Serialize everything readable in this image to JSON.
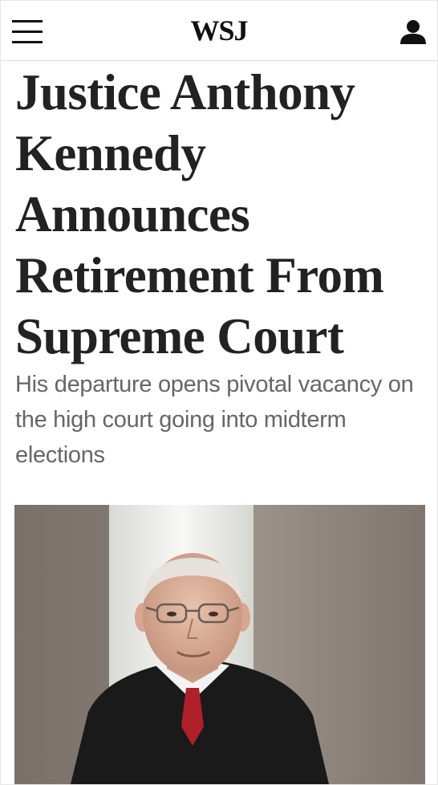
{
  "header": {
    "logo": "WSJ",
    "menu_icon": "hamburger-menu-icon",
    "user_icon": "user-account-icon"
  },
  "article": {
    "headline_lines": [
      "Justice Anthony",
      "Kennedy",
      "Announces",
      "Retirement From",
      "Supreme Court"
    ],
    "dek": "His departure opens pivotal vacancy on the high court going into midterm elections"
  },
  "colors": {
    "headline": "#222222",
    "dek": "#666666",
    "tie": "#b0202a"
  }
}
